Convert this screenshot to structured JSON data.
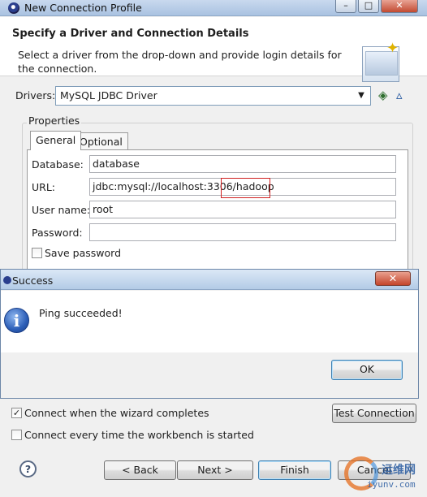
{
  "window": {
    "title": "New Connection Profile",
    "buttons": {
      "minimize": "–",
      "maximize": "□",
      "close": "✕"
    }
  },
  "header": {
    "title": "Specify a Driver and Connection Details",
    "description": "Select a driver from the drop-down and provide login details for the connection."
  },
  "drivers": {
    "label": "Drivers:",
    "selected": "MySQL JDBC Driver",
    "arrow": "▼",
    "new_icon": "◈",
    "edit_icon": "▵"
  },
  "properties": {
    "group_title": "Properties",
    "tabs": [
      {
        "label": "General",
        "active": true
      },
      {
        "label": "Optional",
        "active": false
      }
    ],
    "fields": {
      "database": {
        "label": "Database:",
        "value": "database"
      },
      "url": {
        "label": "URL:",
        "value": "jdbc:mysql://localhost:3306/hadoop"
      },
      "username": {
        "label": "User name:",
        "value": "root"
      },
      "password": {
        "label": "Password:",
        "value": ""
      }
    },
    "save_password": {
      "label": "Save password",
      "checked": false
    }
  },
  "options": {
    "connect_when_completes": {
      "label": "Connect when the wizard completes",
      "checked": true
    },
    "connect_every_time": {
      "label": "Connect every time the workbench is started",
      "checked": false
    },
    "test_connection": "Test Connection"
  },
  "footer": {
    "help": "?",
    "back": "< Back",
    "next": "Next >",
    "finish": "Finish",
    "cancel": "Cancel"
  },
  "dialog": {
    "title": "Success",
    "close": "✕",
    "icon": "i",
    "message": "Ping succeeded!",
    "ok": "OK"
  },
  "watermark": {
    "top": "运维网",
    "bottom": "iyunv.com"
  }
}
